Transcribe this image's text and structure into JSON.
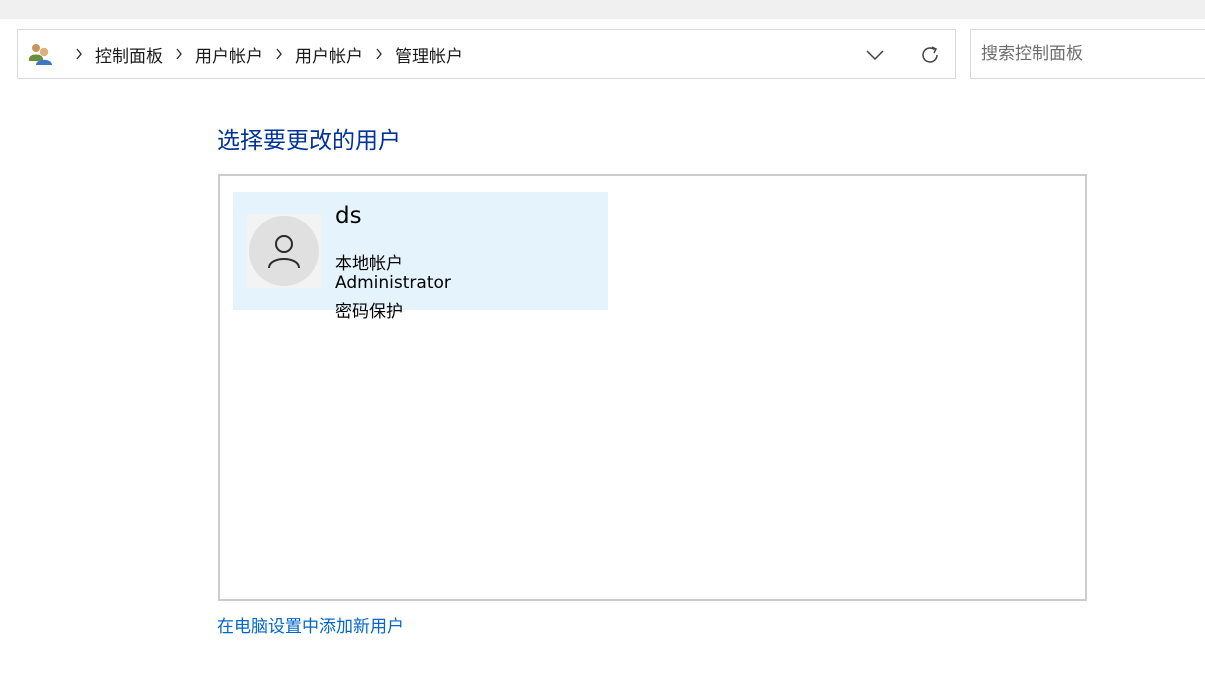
{
  "address_bar": {
    "breadcrumbs": [
      "控制面板",
      "用户帐户",
      "用户帐户",
      "管理帐户"
    ],
    "icon": "user-accounts-icon"
  },
  "search": {
    "placeholder": "搜索控制面板",
    "value": ""
  },
  "main": {
    "title": "选择要更改的用户",
    "users": [
      {
        "name": "ds",
        "type": "本地帐户",
        "role": "Administrator",
        "password": "密码保护",
        "avatar_icon": "user-icon"
      }
    ],
    "add_user_link": "在电脑设置中添加新用户"
  },
  "colors": {
    "title": "#003399",
    "link": "#0066cc",
    "tile_selected": "#e5f3fd",
    "panel_border": "#cccccc"
  }
}
